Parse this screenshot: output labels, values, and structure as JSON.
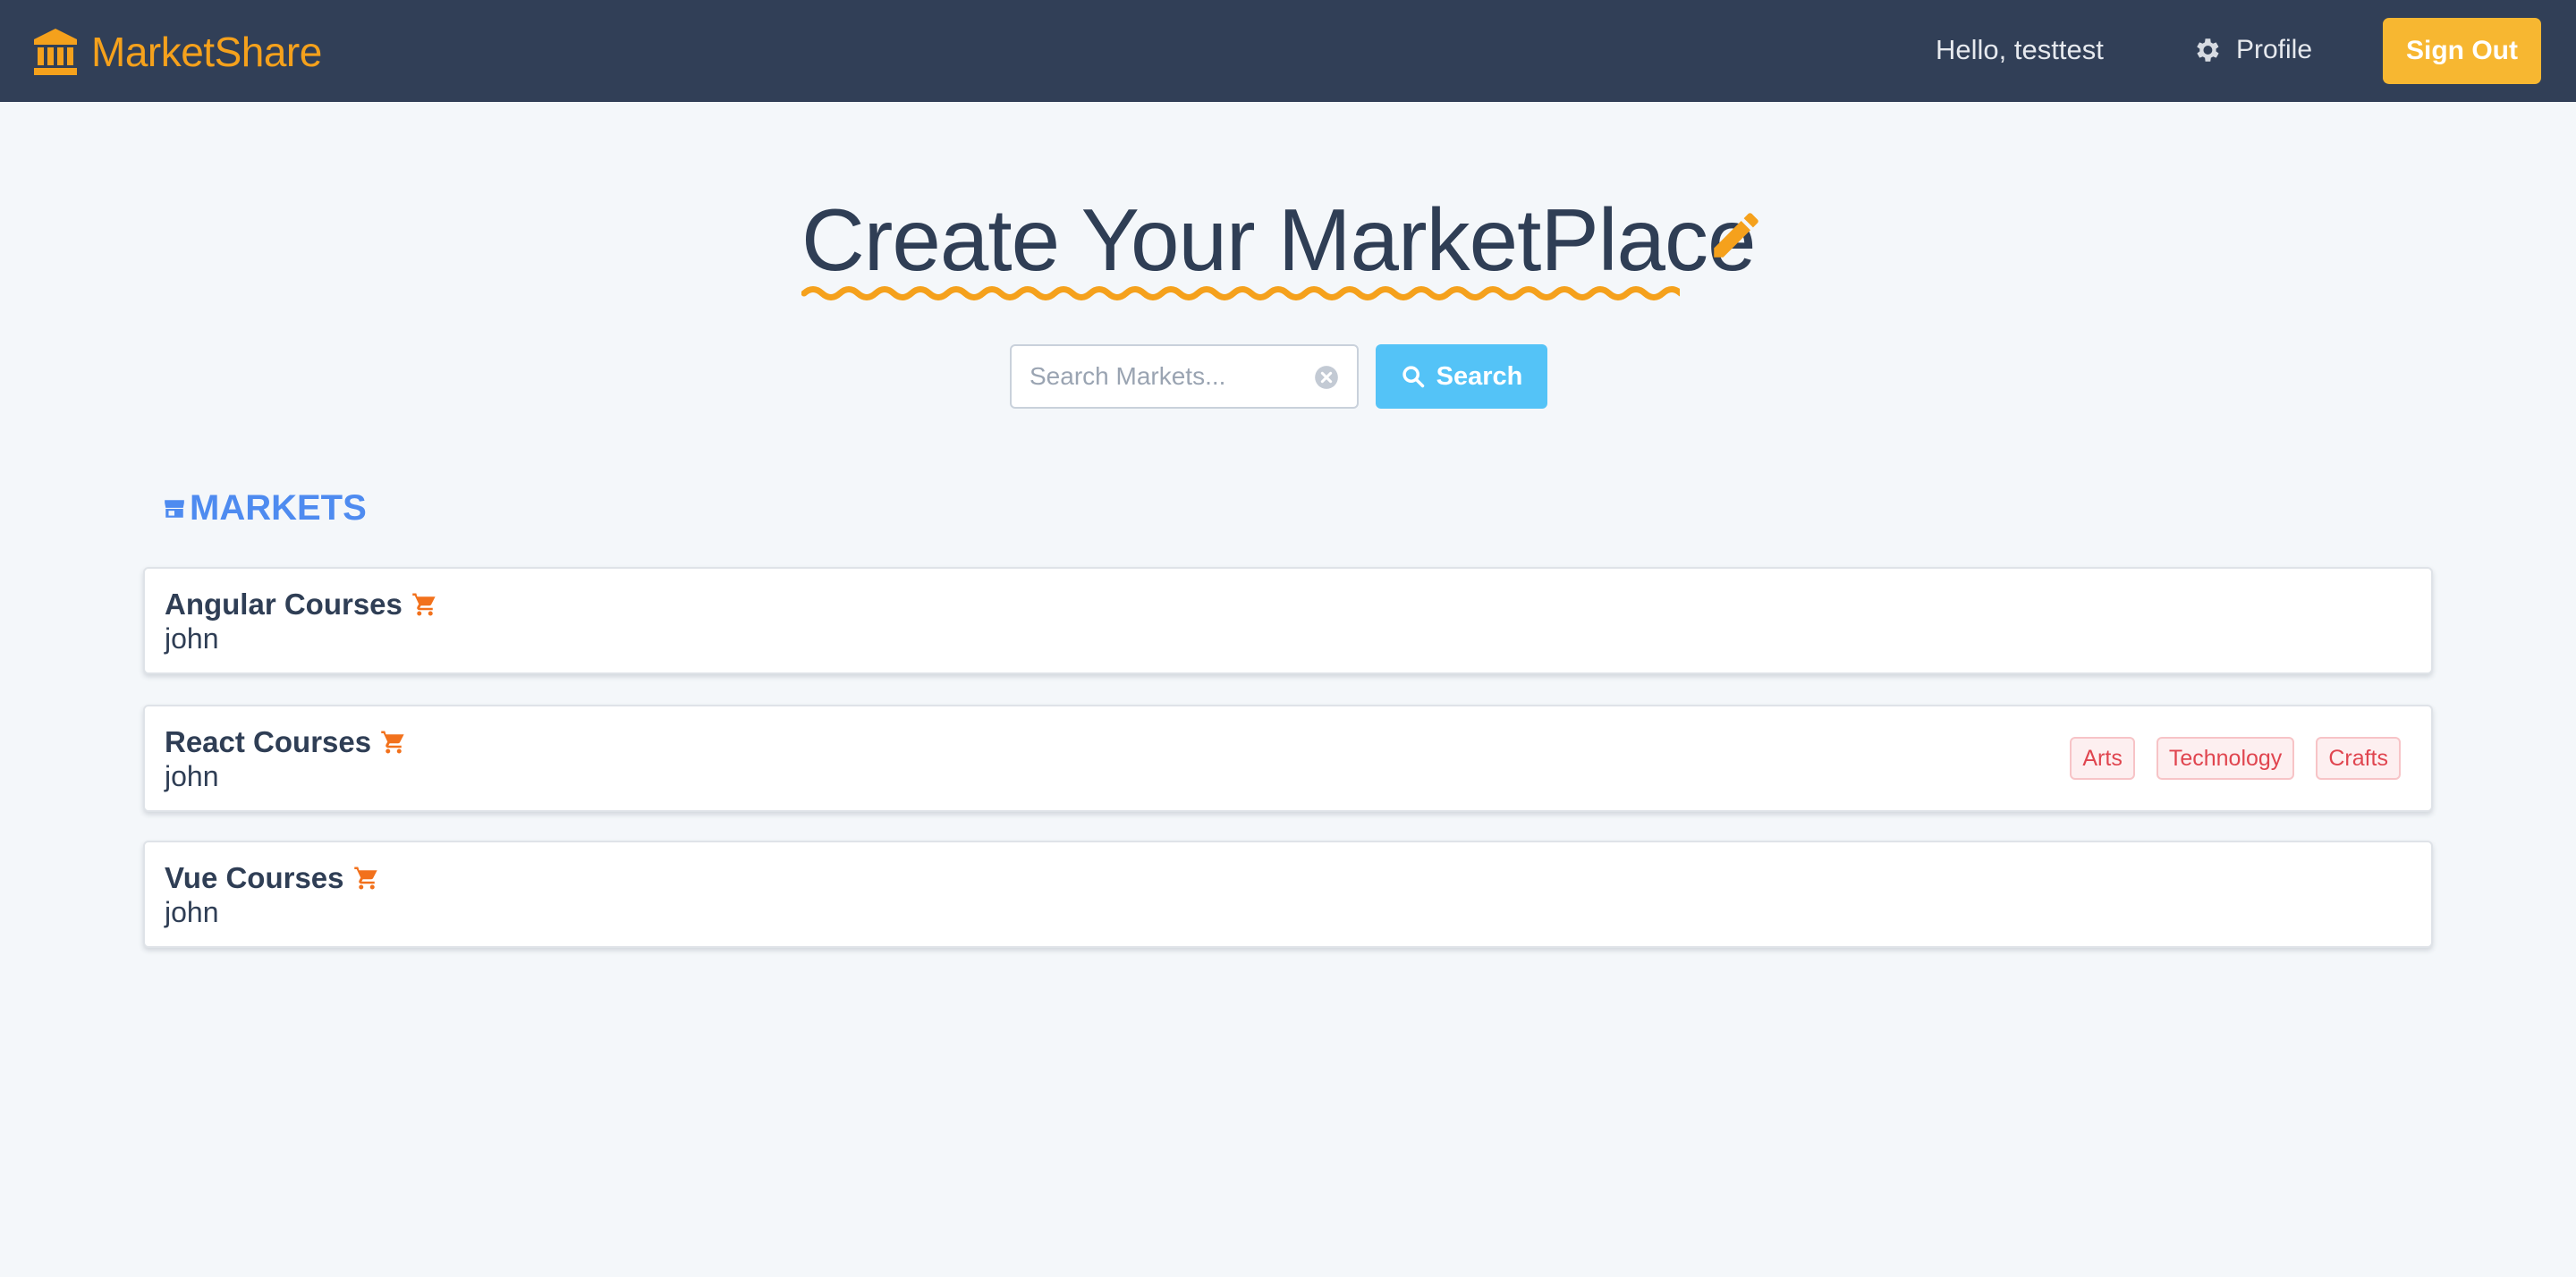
{
  "navbar": {
    "brand_name": "MarketShare",
    "greeting": "Hello, testtest",
    "profile_label": "Profile",
    "signout_label": "Sign Out",
    "brand_color": "#f5a11c",
    "background_color": "#313f57"
  },
  "hero": {
    "title": "Create Your MarketPlace",
    "accent_color": "#f5a11c"
  },
  "search": {
    "placeholder": "Search Markets...",
    "value": "",
    "button_label": "Search",
    "button_color": "#54c3f7"
  },
  "markets_section": {
    "heading": "MARKETS",
    "heading_color": "#4e8bf0",
    "items": [
      {
        "name": "Angular Courses",
        "owner": "john",
        "tags": []
      },
      {
        "name": "React Courses",
        "owner": "john",
        "tags": [
          "Arts",
          "Technology",
          "Crafts"
        ]
      },
      {
        "name": "Vue Courses",
        "owner": "john",
        "tags": []
      }
    ]
  },
  "icons": {
    "brand": "bank-icon",
    "profile": "gear-icon",
    "hero": "pencil-icon",
    "search_clear": "clear-icon",
    "search_button": "search-icon",
    "markets_heading": "store-icon",
    "market_item": "cart-icon"
  }
}
